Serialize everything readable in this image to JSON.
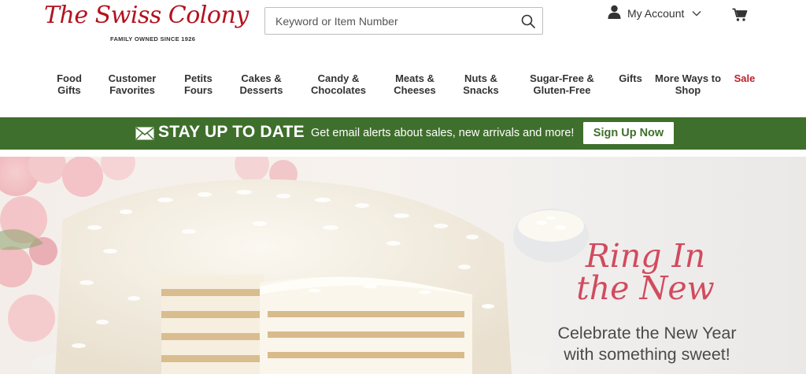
{
  "brand": {
    "name": "The Swiss Colony",
    "tagline": "FAMILY OWNED SINCE 1926",
    "color": "#b3121f"
  },
  "search": {
    "placeholder": "Keyword or Item Number",
    "value": "",
    "icon": "search-icon"
  },
  "account": {
    "label": "My Account",
    "icon": "user-icon",
    "dropdown_icon": "chevron-down-icon"
  },
  "cart": {
    "icon": "cart-icon"
  },
  "nav": {
    "items": [
      {
        "label": "Food\nGifts"
      },
      {
        "label": "Customer\nFavorites"
      },
      {
        "label": "Petits\nFours"
      },
      {
        "label": "Cakes &\nDesserts"
      },
      {
        "label": "Candy &\nChocolates"
      },
      {
        "label": "Meats &\nCheeses"
      },
      {
        "label": "Nuts &\nSnacks"
      },
      {
        "label": "Sugar-Free &\nGluten-Free"
      },
      {
        "label": "Gifts"
      },
      {
        "label": "More Ways to\nShop"
      },
      {
        "label": "Sale"
      }
    ],
    "sale_color": "#c0202b"
  },
  "promo": {
    "title": "STAY UP TO DATE",
    "text": "Get email alerts about sales, new arrivals and more!",
    "button": "Sign Up Now",
    "icon": "envelope-icon",
    "background": "#3f6f2c"
  },
  "hero": {
    "headline": "Ring In\nthe New",
    "subheadline": "Celebrate the New Year\nwith something sweet!",
    "headline_color": "#d14b5e",
    "image": "coconut-cake-image"
  }
}
